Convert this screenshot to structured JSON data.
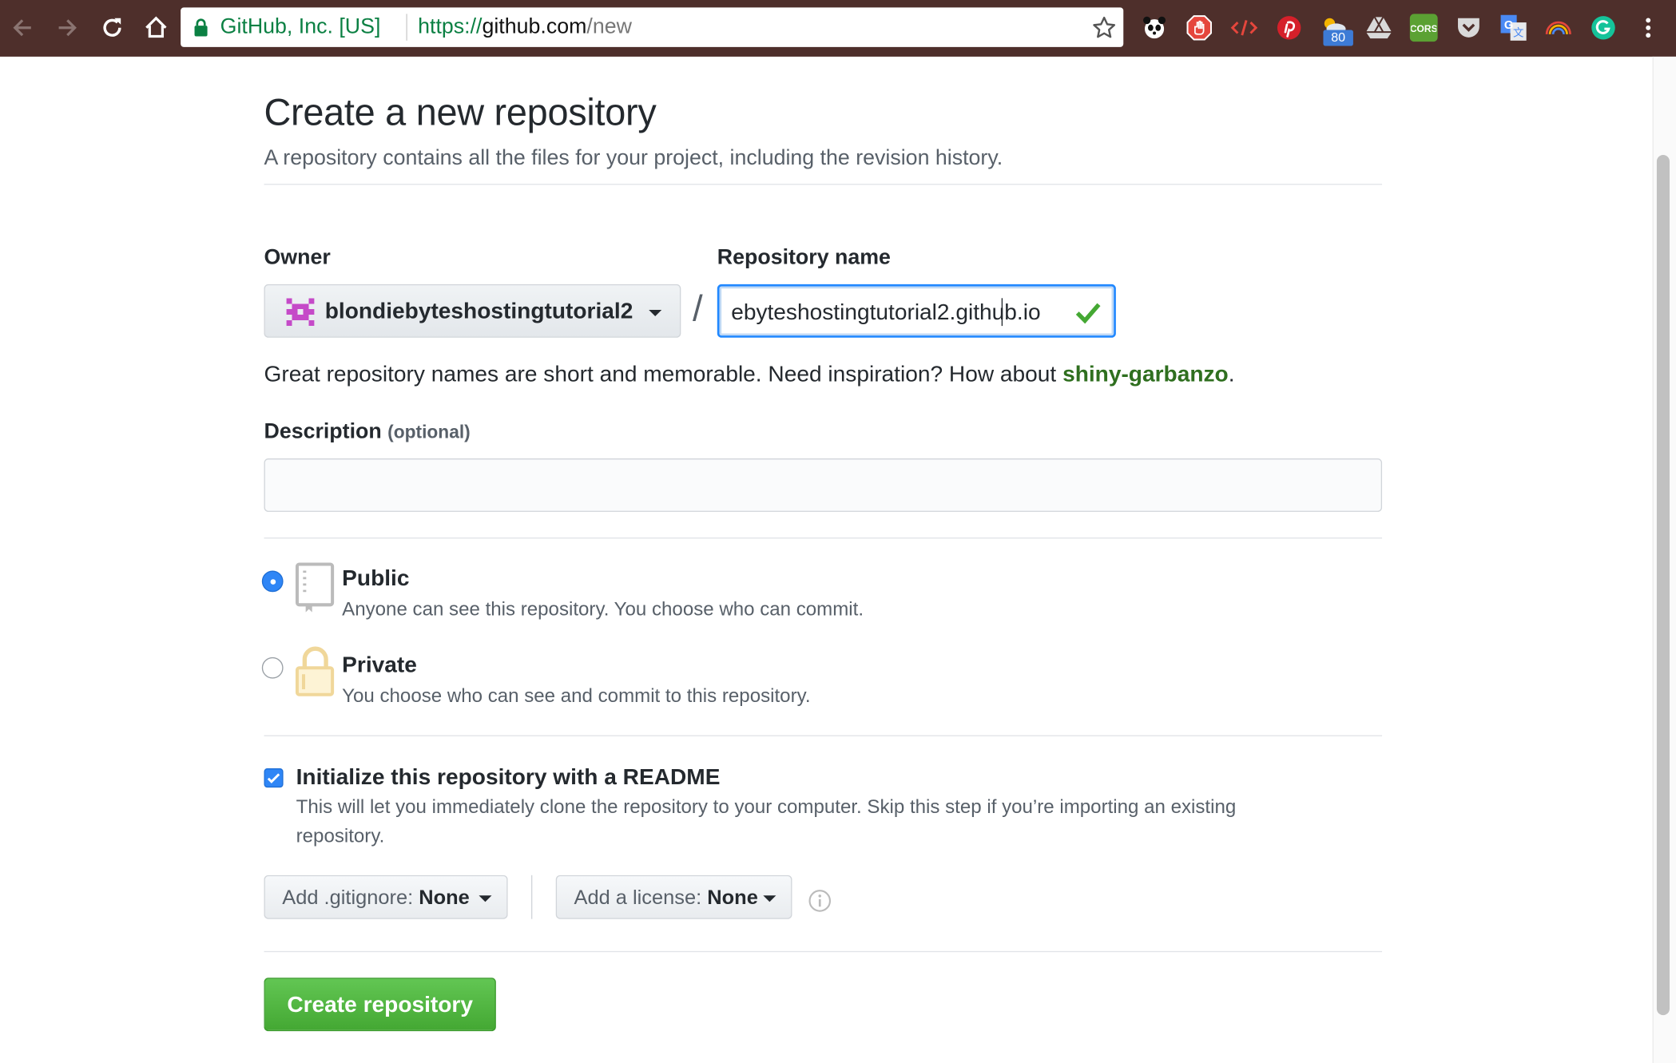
{
  "browser": {
    "ev_label": "GitHub, Inc. [US]",
    "url_scheme": "https://",
    "url_host": "github.com",
    "url_path": "/new",
    "extension_badge": "80",
    "extensions": [
      "panda-icon",
      "adblock-icon",
      "code-brackets-icon",
      "pinterest-icon",
      "weather-icon",
      "drive-icon",
      "cors-icon",
      "pocket-icon",
      "google-translate-icon",
      "rainbow-icon",
      "grammarly-icon"
    ]
  },
  "page": {
    "title": "Create a new repository",
    "subtitle": "A repository contains all the files for your project, including the revision history."
  },
  "owner": {
    "label": "Owner",
    "value": "blondiebyteshostingtutorial2"
  },
  "repo": {
    "label": "Repository name",
    "value": "ebyteshostingtutorial2.github.io",
    "separator": "/"
  },
  "hint": {
    "text": "Great repository names are short and memorable. Need inspiration? How about ",
    "suggestion": "shiny-garbanzo",
    "end": "."
  },
  "description": {
    "label": "Description",
    "optional": "(optional)",
    "value": ""
  },
  "visibility": {
    "public_title": "Public",
    "public_desc": "Anyone can see this repository. You choose who can commit.",
    "private_title": "Private",
    "private_desc": "You choose who can see and commit to this repository.",
    "selected": "public"
  },
  "readme": {
    "title": "Initialize this repository with a README",
    "desc_line1": "This will let you immediately clone the repository to your computer. Skip this step if you’re importing an existing",
    "desc_line2": "repository.",
    "checked": true
  },
  "gitignore": {
    "label": "Add .gitignore:",
    "value": "None"
  },
  "license": {
    "label": "Add a license:",
    "value": "None"
  },
  "submit": {
    "label": "Create repository"
  },
  "colors": {
    "accent_blue": "#2188ff",
    "button_green": "#44a833",
    "suggestion_green": "#2f6f1f",
    "toolbar": "#4e2f2b"
  }
}
